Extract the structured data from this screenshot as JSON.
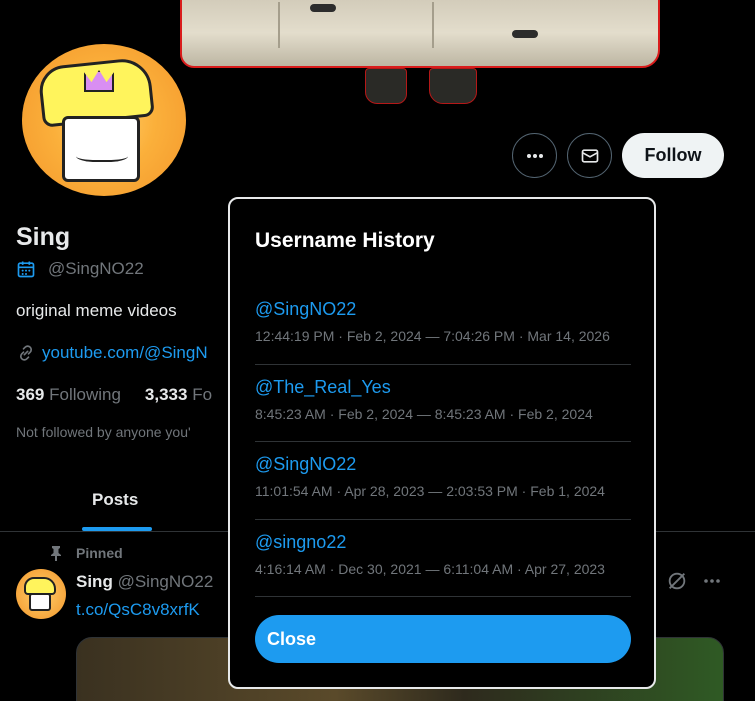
{
  "profile": {
    "name": "Sing",
    "handle": "@SingNO22",
    "bio": "original meme videos",
    "link": "youtube.com/@SingN",
    "following_count": "369",
    "following_label": "Following",
    "followers_count": "3,333",
    "followers_label": "Fo",
    "followed_by": "Not followed by anyone you'"
  },
  "actions": {
    "more_icon": "more-dots-icon",
    "message_icon": "envelope-icon",
    "follow_label": "Follow"
  },
  "tabs": [
    {
      "label": "Posts",
      "active": true
    }
  ],
  "pinned_post": {
    "pinned_label": "Pinned",
    "author": "Sing",
    "handle": "@SingNO22",
    "link": "t.co/QsC8v8xrfK"
  },
  "modal": {
    "title": "Username History",
    "items": [
      {
        "username": "@SingNO22",
        "range": "12:44:19 PM · Feb 2, 2024 — 7:04:26 PM · Mar 14, 2026"
      },
      {
        "username": "@The_Real_Yes",
        "range": "8:45:23 AM · Feb 2, 2024 — 8:45:23 AM · Feb 2, 2024"
      },
      {
        "username": "@SingNO22",
        "range": "11:01:54 AM · Apr 28, 2023 — 2:03:53 PM · Feb 1, 2024"
      },
      {
        "username": "@singno22",
        "range": "4:16:14 AM · Dec 30, 2021 — 6:11:04 AM · Apr 27, 2023"
      }
    ],
    "close_label": "Close"
  },
  "colors": {
    "accent": "#1d9bf0",
    "text_primary": "#e7e9ea",
    "text_secondary": "#71767b",
    "background": "#000000"
  }
}
